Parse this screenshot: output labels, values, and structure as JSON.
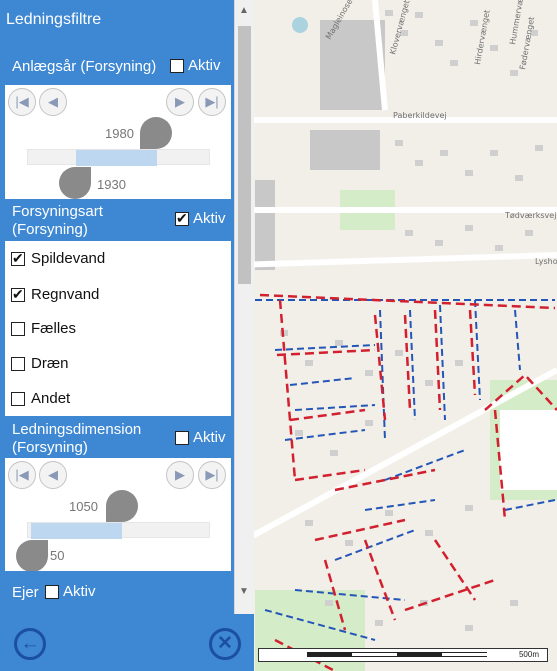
{
  "panel": {
    "title": "Ledningsfiltre",
    "scroll_up": "▲",
    "scroll_down": "▼",
    "back_icon": "←",
    "close_icon": "✕"
  },
  "sections": {
    "anlaegsaar": {
      "title": "Anlægsår (Forsyning)",
      "aktiv_label": "Aktiv",
      "aktiv_checked": false,
      "nav": [
        "|◀",
        "◀",
        "▶",
        "▶|"
      ],
      "upper_value": "1980",
      "lower_value": "1930"
    },
    "forsyningsart": {
      "title_line1": "Forsyningsart",
      "title_line2": "(Forsyning)",
      "aktiv_label": "Aktiv",
      "aktiv_checked": true,
      "items": [
        {
          "label": "Spildevand",
          "checked": true
        },
        {
          "label": "Regnvand",
          "checked": true
        },
        {
          "label": "Fælles",
          "checked": false
        },
        {
          "label": "Dræn",
          "checked": false
        },
        {
          "label": "Andet",
          "checked": false
        }
      ]
    },
    "dimension": {
      "title_line1": "Ledningsdimension",
      "title_line2": "(Forsyning)",
      "aktiv_label": "Aktiv",
      "aktiv_checked": false,
      "nav": [
        "|◀",
        "◀",
        "▶",
        "▶|"
      ],
      "upper_value": "1050",
      "lower_value": "50"
    },
    "ejer": {
      "title": "Ejer",
      "aktiv_label": "Aktiv",
      "aktiv_checked": false
    }
  },
  "map": {
    "street_labels": [
      "Magleinosevej",
      "Klovervænget",
      "Hummervænget",
      "Hirdervænget",
      "Fødervænget",
      "Paberkildevej",
      "Tødværksvej",
      "Lysho"
    ],
    "scale_label": "500m",
    "colors": {
      "spildevand": "#d2202f",
      "regnvand": "#2456b8",
      "building": "#c8c8c8",
      "road": "#ffffff",
      "park": "#d5ecc8"
    }
  }
}
